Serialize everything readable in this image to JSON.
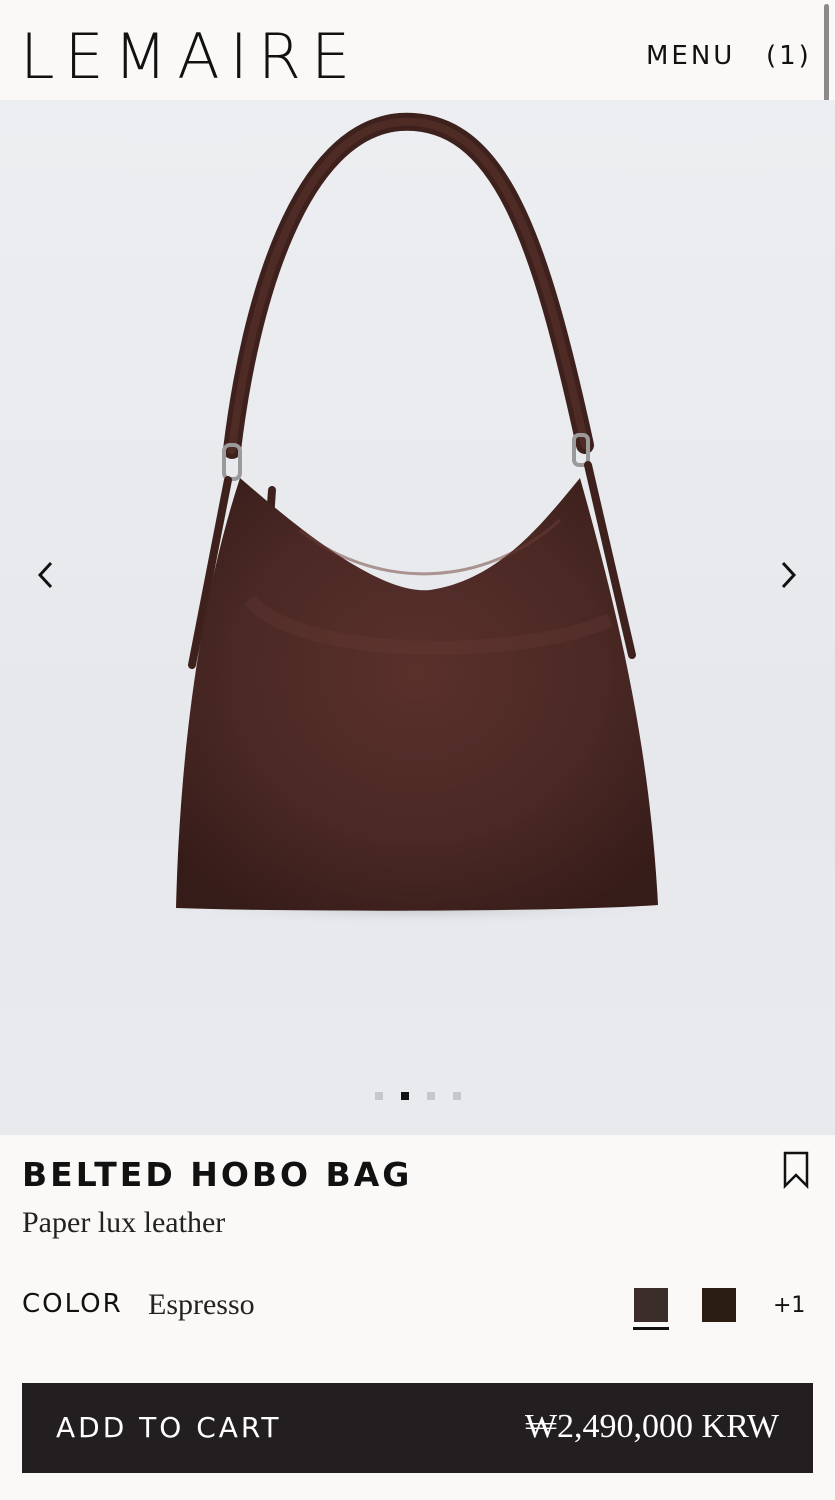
{
  "header": {
    "logo": "LEMAIRE",
    "menu_label": "MENU",
    "cart_count": "(1)"
  },
  "gallery": {
    "image_count": 4,
    "active_index": 1
  },
  "product": {
    "name": "BELTED HOBO BAG",
    "material": "Paper lux leather",
    "color_label": "COLOR",
    "color_value": "Espresso",
    "swatches": [
      {
        "color": "#3a2d2a",
        "selected": true
      },
      {
        "color": "#2b1d12",
        "selected": false
      }
    ],
    "more_colors": "+1"
  },
  "cart": {
    "label": "ADD TO CART",
    "price": "₩2,490,000 KRW"
  },
  "colors": {
    "button_bg": "#231f20",
    "bag": "#4a2824",
    "page_bg": "#faf9f7"
  },
  "icons": [
    "chevron-left-icon",
    "chevron-right-icon",
    "bookmark-icon"
  ]
}
